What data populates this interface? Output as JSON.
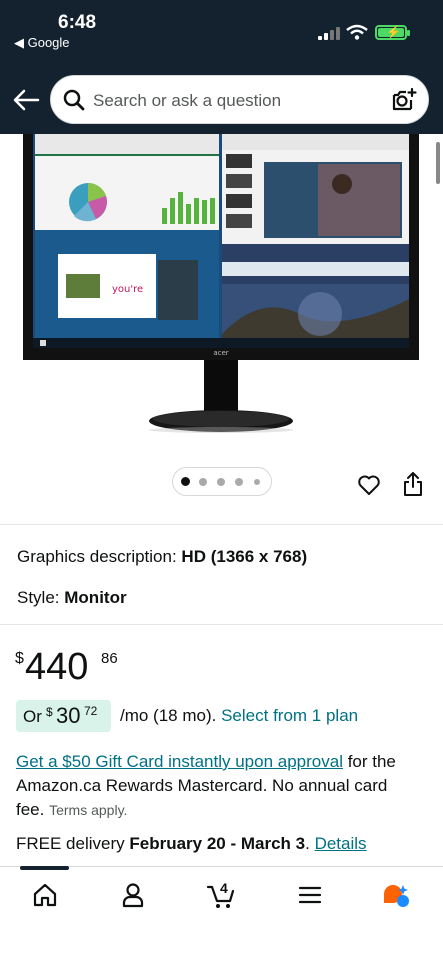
{
  "status": {
    "time": "6:48",
    "back_app": "◀ Google"
  },
  "search": {
    "placeholder": "Search or ask a question"
  },
  "product": {
    "graphics_label": "Graphics description:",
    "graphics_value": "HD (1366 x 768)",
    "style_label": "Style:",
    "style_value": "Monitor",
    "price_currency": "$",
    "price_whole": "440",
    "price_fraction": "86",
    "installment_or": "Or",
    "installment_currency": "$",
    "installment_whole": "30",
    "installment_fraction": "72",
    "installment_term": "/mo (18 mo).",
    "installment_link": "Select from 1 plan",
    "promo_link": "Get a $50 Gift Card instantly upon approval",
    "promo_text": " for the Amazon.ca Rewards Mastercard. No annual card fee. ",
    "promo_terms": "Terms apply.",
    "delivery_prefix": "FREE delivery ",
    "delivery_dates": "February 20 - March 3",
    "delivery_sep": ". ",
    "delivery_link": "Details"
  },
  "image": {
    "brand_logo": "acer",
    "carousel_count": 5,
    "carousel_active": 0
  },
  "bottom_nav": {
    "items": [
      "home-icon",
      "account-icon",
      "cart-icon",
      "menu-icon",
      "rufus-icon"
    ],
    "cart_count": "4"
  },
  "colors": {
    "header": "#14222f",
    "link": "#007185",
    "installment_bg": "#d9f2ea",
    "battery": "#4cd964"
  }
}
